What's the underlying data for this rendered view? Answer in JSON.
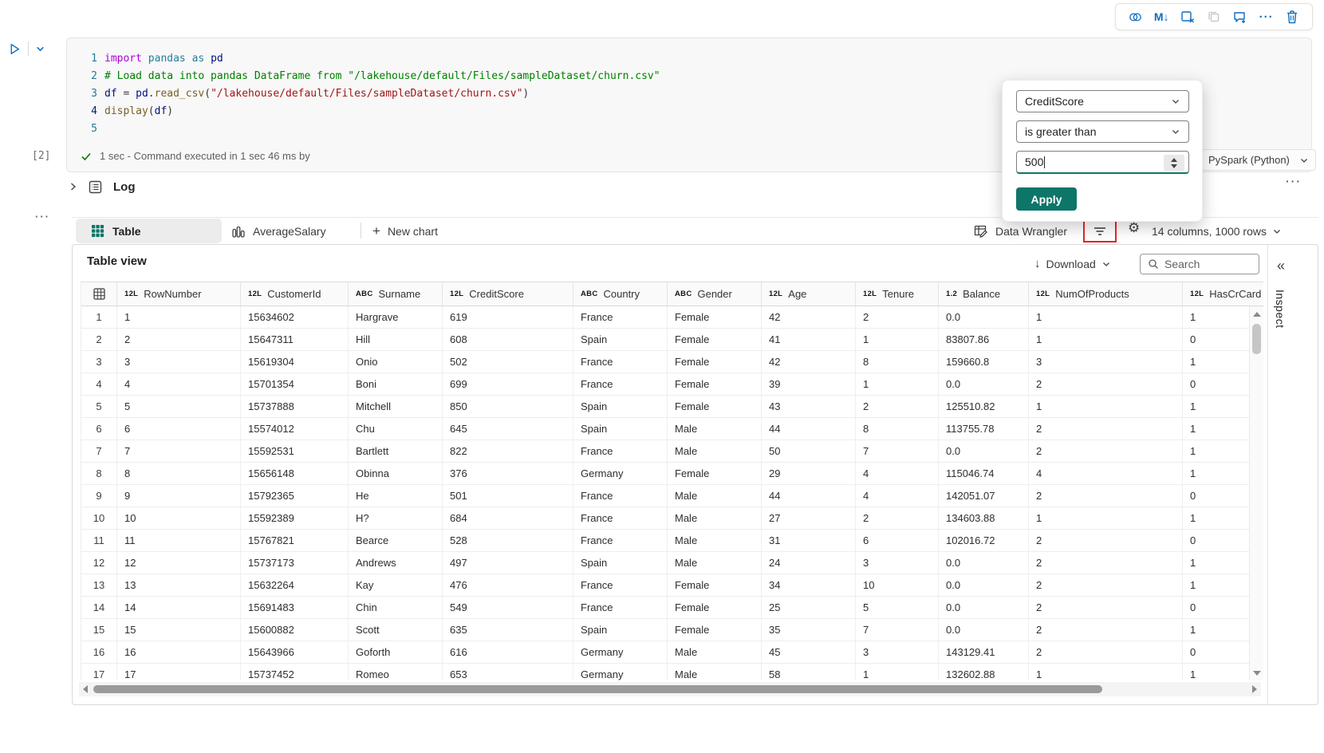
{
  "cell_toolbar": {
    "markdown_glyph": "M↓",
    "more_glyph": "···"
  },
  "cell": {
    "execution_count": "[2]",
    "status_text": "1 sec - Command executed in 1 sec 46 ms by",
    "kernel": "PySpark (Python)",
    "more_glyph": "···",
    "code_lines": [
      {
        "num": "1",
        "active": false,
        "tokens": [
          [
            "import ",
            "kw"
          ],
          [
            "pandas ",
            "ns"
          ],
          [
            "as ",
            "ns"
          ],
          [
            "pd",
            "var"
          ]
        ]
      },
      {
        "num": "2",
        "active": false,
        "tokens": [
          [
            "# Load data into pandas DataFrame from \"/lakehouse/default/Files/sampleDataset/churn.csv\"",
            "com"
          ]
        ]
      },
      {
        "num": "3",
        "active": false,
        "tokens": [
          [
            "df ",
            "var"
          ],
          [
            "= ",
            "plain"
          ],
          [
            "pd",
            "var"
          ],
          [
            ".",
            "plain"
          ],
          [
            "read_csv",
            "fn"
          ],
          [
            "(",
            "plain"
          ],
          [
            "\"/lakehouse/default/Files/sampleDataset/churn.csv\"",
            "str"
          ],
          [
            ")",
            "plain"
          ]
        ]
      },
      {
        "num": "4",
        "active": true,
        "tokens": [
          [
            "display",
            "fn"
          ],
          [
            "(",
            "plain"
          ],
          [
            "df",
            "var"
          ],
          [
            ")",
            "plain"
          ]
        ]
      },
      {
        "num": "5",
        "active": false,
        "tokens": []
      }
    ]
  },
  "log": {
    "label": "Log"
  },
  "output": {
    "left_more_glyph": "···",
    "tabs": {
      "table": "Table",
      "chart": "AverageSalary",
      "new_chart": "New chart",
      "plus_glyph": "+"
    },
    "toolbar": {
      "data_wrangler": "Data Wrangler",
      "summary": "14 columns, 1000 rows"
    }
  },
  "filter_popup": {
    "column": "CreditScore",
    "operator": "is greater than",
    "value": "500",
    "apply_label": "Apply"
  },
  "table_view": {
    "title": "Table view",
    "download_label": "Download",
    "download_arrow": "↓",
    "search_placeholder": "Search",
    "collapse_glyph": "«",
    "inspect_label": "Inspect",
    "gear_glyph": "⚙",
    "columns": [
      {
        "type": "12L",
        "name": "RowNumber"
      },
      {
        "type": "12L",
        "name": "CustomerId"
      },
      {
        "type": "ABC",
        "name": "Surname"
      },
      {
        "type": "12L",
        "name": "CreditScore"
      },
      {
        "type": "ABC",
        "name": "Country"
      },
      {
        "type": "ABC",
        "name": "Gender"
      },
      {
        "type": "12L",
        "name": "Age"
      },
      {
        "type": "12L",
        "name": "Tenure"
      },
      {
        "type": "1.2",
        "name": "Balance"
      },
      {
        "type": "12L",
        "name": "NumOfProducts"
      },
      {
        "type": "12L",
        "name": "HasCrCard"
      }
    ],
    "rows": [
      [
        "1",
        "15634602",
        "Hargrave",
        "619",
        "France",
        "Female",
        "42",
        "2",
        "0.0",
        "1",
        "1"
      ],
      [
        "2",
        "15647311",
        "Hill",
        "608",
        "Spain",
        "Female",
        "41",
        "1",
        "83807.86",
        "1",
        "0"
      ],
      [
        "3",
        "15619304",
        "Onio",
        "502",
        "France",
        "Female",
        "42",
        "8",
        "159660.8",
        "3",
        "1"
      ],
      [
        "4",
        "15701354",
        "Boni",
        "699",
        "France",
        "Female",
        "39",
        "1",
        "0.0",
        "2",
        "0"
      ],
      [
        "5",
        "15737888",
        "Mitchell",
        "850",
        "Spain",
        "Female",
        "43",
        "2",
        "125510.82",
        "1",
        "1"
      ],
      [
        "6",
        "15574012",
        "Chu",
        "645",
        "Spain",
        "Male",
        "44",
        "8",
        "113755.78",
        "2",
        "1"
      ],
      [
        "7",
        "15592531",
        "Bartlett",
        "822",
        "France",
        "Male",
        "50",
        "7",
        "0.0",
        "2",
        "1"
      ],
      [
        "8",
        "15656148",
        "Obinna",
        "376",
        "Germany",
        "Female",
        "29",
        "4",
        "115046.74",
        "4",
        "1"
      ],
      [
        "9",
        "15792365",
        "He",
        "501",
        "France",
        "Male",
        "44",
        "4",
        "142051.07",
        "2",
        "0"
      ],
      [
        "10",
        "15592389",
        "H?",
        "684",
        "France",
        "Male",
        "27",
        "2",
        "134603.88",
        "1",
        "1"
      ],
      [
        "11",
        "15767821",
        "Bearce",
        "528",
        "France",
        "Male",
        "31",
        "6",
        "102016.72",
        "2",
        "0"
      ],
      [
        "12",
        "15737173",
        "Andrews",
        "497",
        "Spain",
        "Male",
        "24",
        "3",
        "0.0",
        "2",
        "1"
      ],
      [
        "13",
        "15632264",
        "Kay",
        "476",
        "France",
        "Female",
        "34",
        "10",
        "0.0",
        "2",
        "1"
      ],
      [
        "14",
        "15691483",
        "Chin",
        "549",
        "France",
        "Female",
        "25",
        "5",
        "0.0",
        "2",
        "0"
      ],
      [
        "15",
        "15600882",
        "Scott",
        "635",
        "Spain",
        "Female",
        "35",
        "7",
        "0.0",
        "2",
        "1"
      ],
      [
        "16",
        "15643966",
        "Goforth",
        "616",
        "Germany",
        "Male",
        "45",
        "3",
        "143129.41",
        "2",
        "0"
      ],
      [
        "17",
        "15737452",
        "Romeo",
        "653",
        "Germany",
        "Male",
        "58",
        "1",
        "132602.88",
        "1",
        "1"
      ]
    ]
  },
  "colors": {
    "accent_teal": "#0e7569",
    "icon_blue": "#0f6cbd",
    "highlight_red": "#e8232a"
  }
}
